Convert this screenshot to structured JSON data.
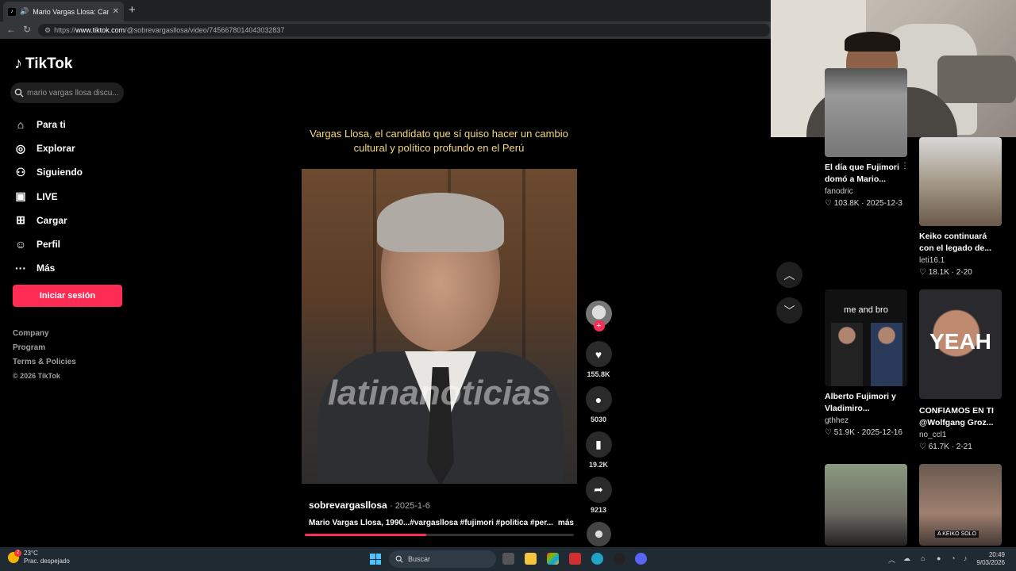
{
  "browser": {
    "tab_title": "Mario Vargas Llosa: Cambio C",
    "url_prefix": "https://",
    "url_host": "www.tiktok.com",
    "url_path": "/@sobrevargasllosa/video/7456678014043032837"
  },
  "sidebar": {
    "logo": "TikTok",
    "search_value": "mario vargas llosa discu...",
    "menu": [
      {
        "label": "Para ti",
        "icon": "home-icon"
      },
      {
        "label": "Explorar",
        "icon": "compass-icon"
      },
      {
        "label": "Siguiendo",
        "icon": "following-icon"
      },
      {
        "label": "LIVE",
        "icon": "live-icon"
      },
      {
        "label": "Cargar",
        "icon": "upload-icon"
      },
      {
        "label": "Perfil",
        "icon": "profile-icon"
      },
      {
        "label": "Más",
        "icon": "more-icon"
      }
    ],
    "login_label": "Iniciar sesión",
    "footer": [
      "Company",
      "Program",
      "Terms & Policies",
      "© 2026 TikTok"
    ]
  },
  "video": {
    "top_caption": "Vargas Llosa, el candidato que sí quiso hacer un cambio cultural y político profundo en el Perú",
    "watermark": "latinanoticias",
    "author": "sobrevargasllosa",
    "date": "2025-1-6",
    "description": "Mario Vargas Llosa, 1990...#vargasllosa #fujimori #politica #per...",
    "more_label": "más",
    "progress_fraction": 0.45
  },
  "actions": {
    "likes": "155.8K",
    "comments": "5030",
    "saves": "19.2K",
    "shares": "9213"
  },
  "recommendations": [
    {
      "title": "El día que Fujimori domó a Mario...",
      "user": "fanodric",
      "likes": "103.8K",
      "date": "2025-12-3"
    },
    {
      "title": "Keiko continuará con el legado de...",
      "user": "leti16.1",
      "likes": "18.1K",
      "date": "2-20"
    },
    {
      "title": "Alberto Fujimori y Vladimiro...",
      "user": "gthhez",
      "likes": "51.9K",
      "date": "2025-12-16",
      "overlay": "me and bro"
    },
    {
      "title": "CONFIAMOS EN TI @Wolfgang Groz...",
      "user": "no_ccl1",
      "likes": "61.7K",
      "date": "2-21",
      "overlay": "YEAH"
    },
    {
      "overlay": ""
    },
    {
      "overlay": "A KEIKO SOLO"
    }
  ],
  "taskbar": {
    "temperature": "23°C",
    "weather_text": "Prac. despejado",
    "weather_badge": "2",
    "search_label": "Buscar",
    "time": "20:49",
    "date": "9/03/2026"
  },
  "colors": {
    "accent": "#fe2c55",
    "caption": "#f4d97b"
  }
}
